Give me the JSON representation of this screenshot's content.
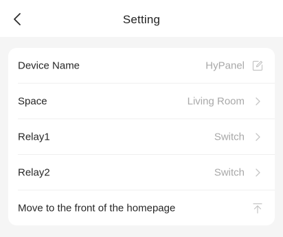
{
  "header": {
    "title": "Setting",
    "back_icon": "chevron-left-icon"
  },
  "settings": {
    "rows": [
      {
        "label": "Device Name",
        "value": "HyPanel",
        "icon": "edit-icon"
      },
      {
        "label": "Space",
        "value": "Living Room",
        "icon": "chevron-right-icon"
      },
      {
        "label": "Relay1",
        "value": "Switch",
        "icon": "chevron-right-icon"
      },
      {
        "label": "Relay2",
        "value": "Switch",
        "icon": "chevron-right-icon"
      },
      {
        "label": "Move to the front of the homepage",
        "value": "",
        "icon": "move-to-top-icon"
      }
    ]
  },
  "colors": {
    "background": "#f5f5f5",
    "card": "#ffffff",
    "label": "#262626",
    "value": "#a8a8a8",
    "icon": "#c4c4c4"
  }
}
